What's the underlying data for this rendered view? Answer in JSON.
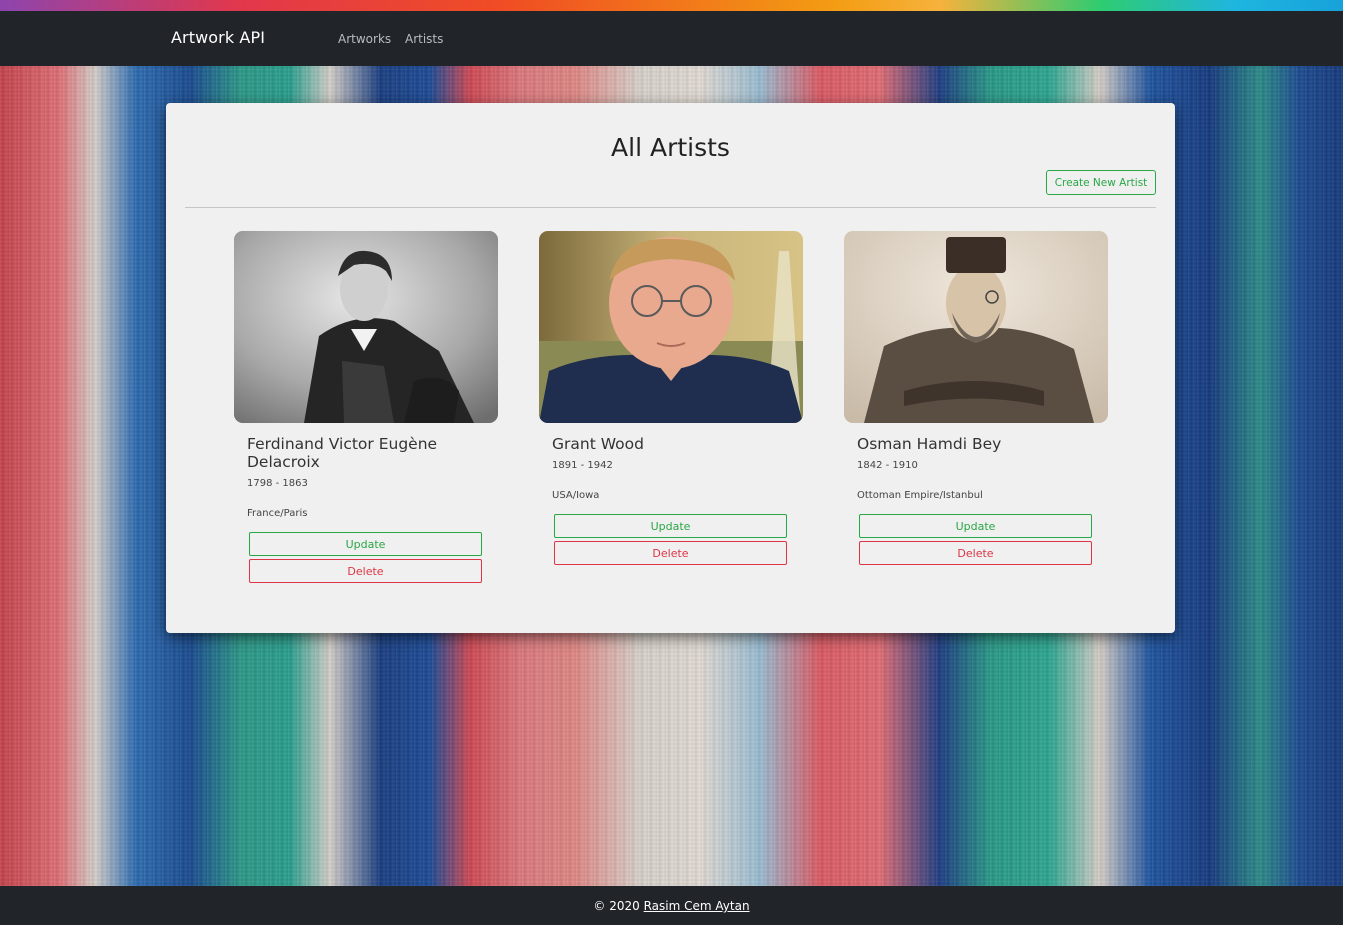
{
  "navbar": {
    "brand": "Artwork API",
    "links": [
      "Artworks",
      "Artists"
    ]
  },
  "main": {
    "title": "All Artists",
    "create_button": "Create New Artist"
  },
  "artists": [
    {
      "name": "Ferdinand Victor Eugène Delacroix",
      "years": "1798 - 1863",
      "location": "France/Paris",
      "portrait": "portrait-photo-bw",
      "update_label": "Update",
      "delete_label": "Delete"
    },
    {
      "name": "Grant Wood",
      "years": "1891 - 1942",
      "location": "USA/Iowa",
      "portrait": "portrait-painting-color",
      "update_label": "Update",
      "delete_label": "Delete"
    },
    {
      "name": "Osman Hamdi Bey",
      "years": "1842 - 1910",
      "location": "Ottoman Empire/Istanbul",
      "portrait": "portrait-photo-sepia",
      "update_label": "Update",
      "delete_label": "Delete"
    }
  ],
  "footer": {
    "copyright": "© 2020",
    "author": "Rasim Cem Aytan"
  },
  "colors": {
    "navbar": "#212529",
    "success": "#28a745",
    "danger": "#dc3545",
    "panel": "#f0f0f0"
  }
}
